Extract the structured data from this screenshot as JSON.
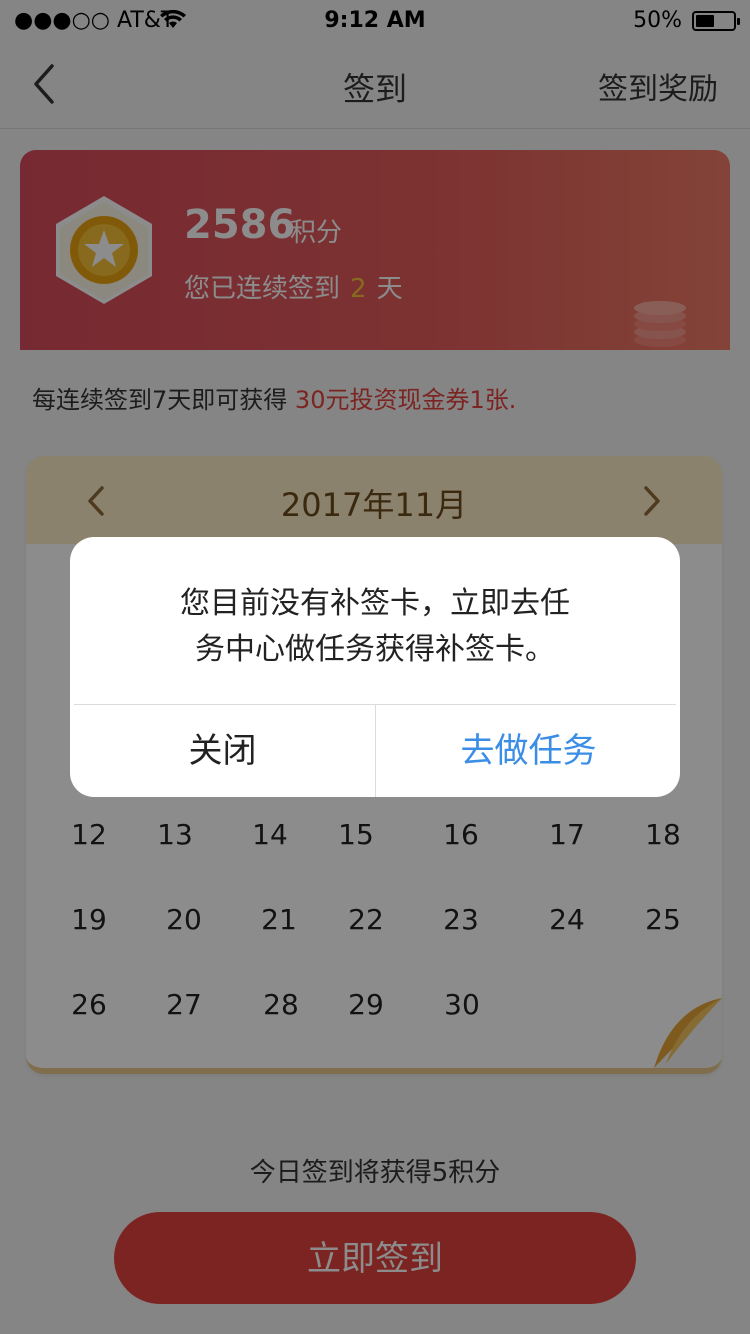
{
  "status_bar": {
    "carrier": "●●●○○ AT&T",
    "time": "9:12 AM",
    "battery": "50%",
    "battery_level": 0.5
  },
  "nav": {
    "title": "签到",
    "reward_link": "签到奖励"
  },
  "points_card": {
    "points": "2586",
    "points_unit": "积分",
    "streak_prefix": "您已连续签到",
    "streak_days": "2",
    "streak_suffix": "天"
  },
  "hint": {
    "prefix": "每连续签到7天即可获得",
    "highlight": "30元投资现金券1张."
  },
  "calendar": {
    "month": "2017年11月",
    "week_rows": [
      [
        "12",
        "13",
        "14",
        "15",
        "16",
        "17",
        "18"
      ],
      [
        "19",
        "20",
        "21",
        "22",
        "23",
        "24",
        "25"
      ],
      [
        "26",
        "27",
        "28",
        "29",
        "30"
      ]
    ]
  },
  "footer": {
    "today_gain": "今日签到将获得5积分",
    "signin_button": "立即签到"
  },
  "dialog": {
    "message_line1": "您目前没有补签卡，立即去任",
    "message_line2": "务中心做任务获得补签卡。",
    "close_button": "关闭",
    "task_button": "去做任务"
  },
  "colors": {
    "brand_red": "#e2433d",
    "link_blue": "#3a8ee6",
    "calendar_header": "#fcedc6",
    "streak_yellow": "#f7c23a"
  }
}
